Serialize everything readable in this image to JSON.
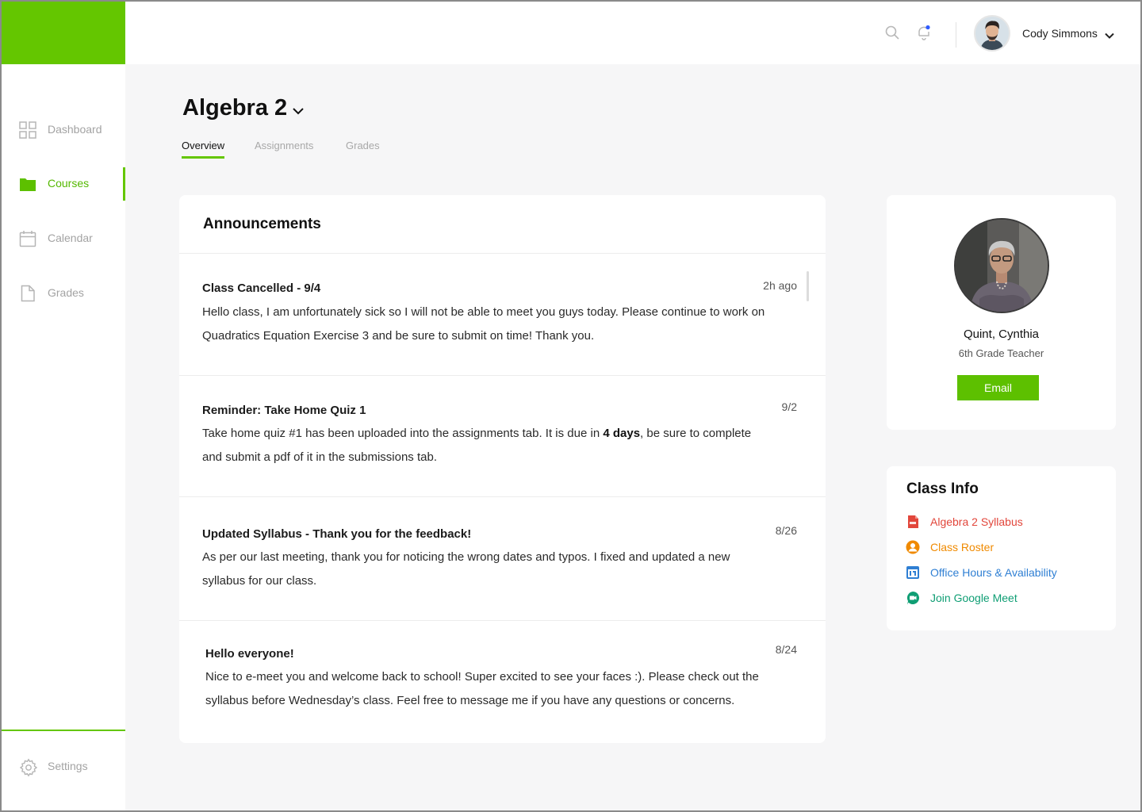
{
  "sidebar": {
    "items": [
      {
        "label": "Dashboard",
        "icon": "grid-icon",
        "active": false
      },
      {
        "label": "Courses",
        "icon": "folder-icon",
        "active": true
      },
      {
        "label": "Calendar",
        "icon": "calendar-icon",
        "active": false
      },
      {
        "label": "Grades",
        "icon": "document-icon",
        "active": false
      }
    ],
    "settings_label": "Settings"
  },
  "topbar": {
    "user_name": "Cody Simmons"
  },
  "course": {
    "title": "Algebra 2",
    "tabs": [
      {
        "label": "Overview",
        "active": true
      },
      {
        "label": "Assignments",
        "active": false
      },
      {
        "label": "Grades",
        "active": false
      }
    ]
  },
  "announcements": {
    "title": "Announcements",
    "items": [
      {
        "title": "Class Cancelled - 9/4",
        "time": "2h ago",
        "body": "Hello class, I am unfortunately sick so I will not be able to meet you guys today. Please continue to work on Quadratics Equation Exercise 3 and be sure to submit on time! Thank you."
      },
      {
        "title": "Reminder: Take Home Quiz 1",
        "time": "9/2",
        "body_before": "Take home quiz #1 has been uploaded into the assignments tab. It is due in ",
        "body_bold": "4 days",
        "body_after": ", be sure to complete and submit a pdf of it in the submissions tab."
      },
      {
        "title": "Updated Syllabus - Thank you for the feedback!",
        "time": "8/26",
        "body": "As per our last meeting, thank you for noticing the wrong dates and typos. I fixed and updated a new syllabus for our class."
      },
      {
        "title": "Hello everyone!",
        "time": "8/24",
        "body": "Nice to e-meet you and welcome back to school! Super excited to see your faces :). Please check out the syllabus before Wednesday’s class. Feel free to message me if you have any questions or concerns."
      }
    ]
  },
  "teacher": {
    "name": "Quint, Cynthia",
    "role": "6th Grade Teacher",
    "email_label": "Email"
  },
  "class_info": {
    "title": "Class Info",
    "links": [
      {
        "label": "Algebra 2 Syllabus",
        "icon": "pdf-icon",
        "color": "#e2463b"
      },
      {
        "label": "Class Roster",
        "icon": "user-circle-icon",
        "color": "#f08a00"
      },
      {
        "label": "Office Hours & Availability",
        "icon": "google-calendar-icon",
        "color": "#2f7fd3"
      },
      {
        "label": "Join Google Meet",
        "icon": "google-meet-icon",
        "color": "#0f9e74"
      }
    ]
  },
  "colors": {
    "accent": "#64c600",
    "page_bg": "#f6f6f7"
  }
}
